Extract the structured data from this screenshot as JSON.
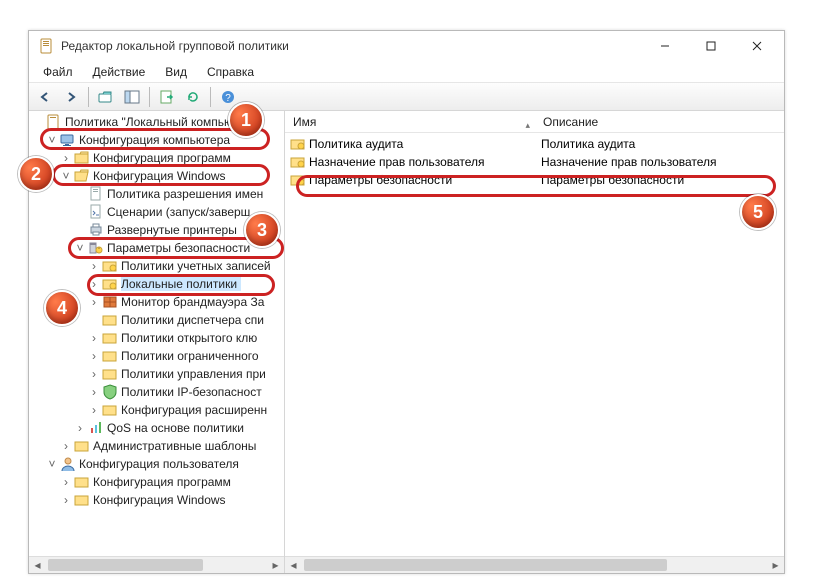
{
  "window": {
    "title": "Редактор локальной групповой политики"
  },
  "menu": {
    "file": "Файл",
    "action": "Действие",
    "view": "Вид",
    "help": "Справка"
  },
  "tree": {
    "root": "Политика \"Локальный компью",
    "comp_cfg": "Конфигурация компьютера",
    "comp_prog": "Конфигурация программ",
    "comp_win": "Конфигурация Windows",
    "name_policy": "Политика разрешения имен",
    "scripts": "Сценарии (запуск/заверш",
    "deployed_printers": "Развернутые принтеры",
    "security": "Параметры безопасности",
    "acct_policies": "Политики учетных записей",
    "local_policies": "Локальные политики",
    "firewall": "Монитор брандмауэра За",
    "nlm": "Политики диспетчера спи",
    "pubkey": "Политики открытого клю",
    "restricted": "Политики ограниченного",
    "appctrl": "Политики управления при",
    "ipsec": "Политики IP-безопасност",
    "advaudit": "Конфигурация расширенн",
    "qos": "QoS на основе политики",
    "admtpl": "Административные шаблоны",
    "user_cfg": "Конфигурация пользователя",
    "user_prog": "Конфигурация программ",
    "user_win": "Конфигурация Windows"
  },
  "list": {
    "col_name": "Имя",
    "col_desc": "Описание",
    "rows": [
      {
        "name": "Политика аудита",
        "desc": "Политика аудита"
      },
      {
        "name": "Назначение прав пользователя",
        "desc": "Назначение прав пользователя"
      },
      {
        "name": "Параметры безопасности",
        "desc": "Параметры безопасности"
      }
    ]
  },
  "ann": {
    "a1": "1",
    "a2": "2",
    "a3": "3",
    "a4": "4",
    "a5": "5"
  }
}
